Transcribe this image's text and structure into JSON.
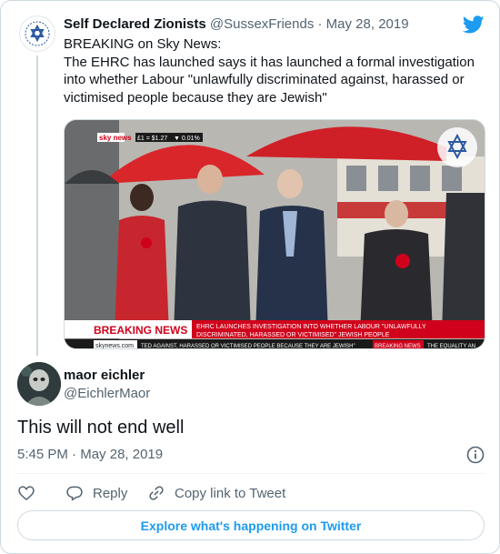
{
  "quoted_tweet": {
    "display_name": "Self Declared Zionists",
    "handle": "@SussexFriends",
    "separator": "·",
    "date": "May 28, 2019",
    "text": "BREAKING on Sky News:\nThe EHRC has launched says it has launched a formal investigation into whether Labour \"unlawfully discriminated  against, harassed or victimised people because they are Jewish\"",
    "avatar_icon": "star-of-david-logo-icon",
    "media": {
      "channel_logo": "sky news",
      "ticker_rate": "£1 = $1.27",
      "ticker_change": "▼ 0.01%",
      "breaking_label": "BREAKING NEWS",
      "headline_line1": "EHRC LAUNCHES INVESTIGATION INTO WHETHER LABOUR \"UNLAWFULLY",
      "headline_line2": "DISCRIMINATED, HARASSED OR VICTIMISED\" JEWISH PEOPLE",
      "site": "skynews.com",
      "crawl_text": "TED AGAINST, HARASSED OR VICTIMISED PEOPLE BECAUSE THEY ARE JEWISH\"",
      "crawl_label": "BREAKING NEWS",
      "crawl_tail": "THE EQUALITY AN"
    }
  },
  "tweet": {
    "display_name": "maor eichler",
    "handle": "@EichlerMaor",
    "text": "This will not end well",
    "time": "5:45 PM",
    "separator": "·",
    "date": "May 28, 2019"
  },
  "actions": {
    "reply": "Reply",
    "copy_link": "Copy link to Tweet"
  },
  "explore_label": "Explore what's happening on Twitter",
  "colors": {
    "twitter_blue": "#1d9bf0",
    "sky_red": "#d0021b",
    "text_primary": "#0f1419",
    "text_secondary": "#536471"
  }
}
